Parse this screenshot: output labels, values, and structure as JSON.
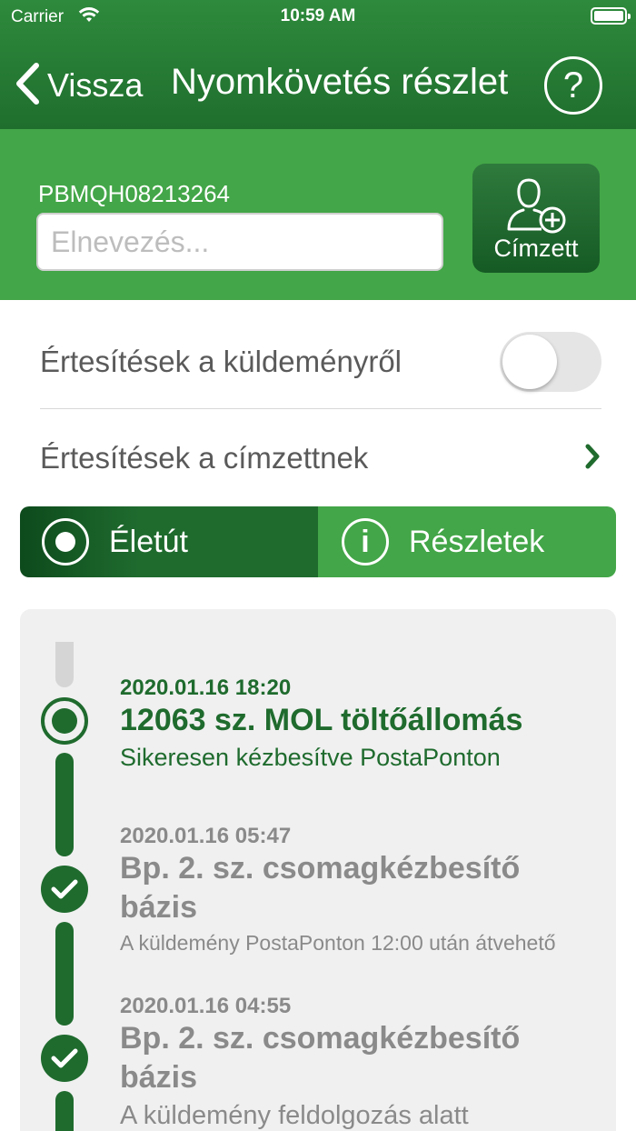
{
  "status_bar": {
    "carrier": "Carrier",
    "time": "10:59 AM"
  },
  "nav": {
    "back_label": "Vissza",
    "title": "Nyomkövetés részlet",
    "help_label": "?"
  },
  "shipment": {
    "tracking_number": "PBMQH08213264",
    "name_placeholder": "Elnevezés...",
    "name_value": "",
    "recipient_button": "Címzett"
  },
  "settings": {
    "shipment_notifications": {
      "label": "Értesítések a küldeményről",
      "enabled": false
    },
    "recipient_notifications": {
      "label": "Értesítések a címzettnek"
    }
  },
  "tabs": [
    {
      "label": "Életút",
      "active": true
    },
    {
      "label": "Részletek",
      "active": false
    }
  ],
  "timeline": [
    {
      "date": "2020.01.16 18:20",
      "place": "12063 sz. MOL töltőállomás",
      "description": "Sikeresen kézbesítve PostaPonton",
      "status": "current"
    },
    {
      "date": "2020.01.16 05:47",
      "place": "Bp. 2. sz. csomagkézbesítő bázis",
      "description": "A küldemény PostaPonton 12:00 után átvehető",
      "status": "done"
    },
    {
      "date": "2020.01.16 04:55",
      "place": "Bp. 2. sz. csomagkézbesítő bázis",
      "description": "A küldemény feldolgozás alatt",
      "status": "done"
    }
  ],
  "colors": {
    "header": "#1f6e2d",
    "panel": "#43a648",
    "dark_green": "#1f6b2e",
    "muted_text": "#8a8a8a"
  }
}
